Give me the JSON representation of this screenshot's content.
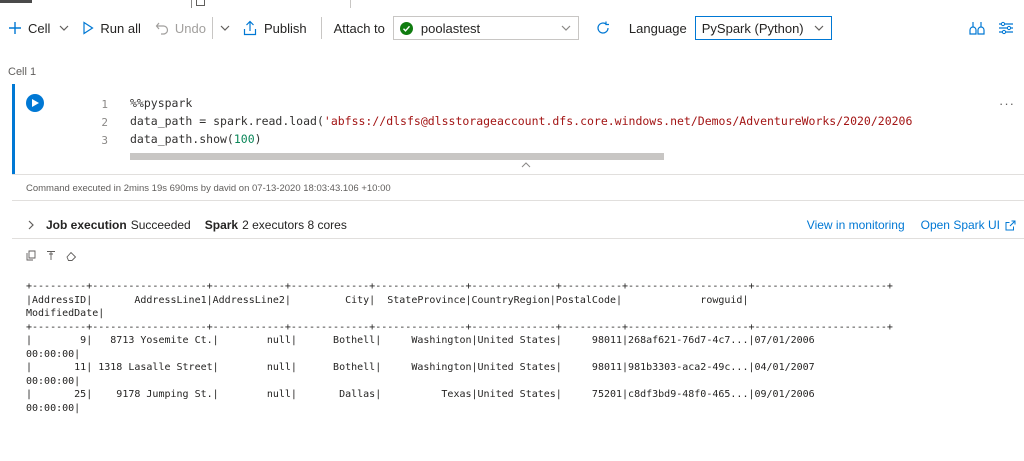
{
  "toolbar": {
    "cell_label": "Cell",
    "run_all_label": "Run all",
    "undo_label": "Undo",
    "publish_label": "Publish",
    "attach_label": "Attach to",
    "attach_value": "poolastest",
    "language_label": "Language",
    "language_value": "PySpark (Python)"
  },
  "cell": {
    "label": "Cell 1",
    "lines": [
      {
        "num": "1",
        "text": "%%pyspark"
      },
      {
        "num": "2",
        "prefix": "data_path = ",
        "spark": "spark",
        "mid": ".read.load(",
        "str": "'abfss://dlsfs@dlsstorageaccount.dfs.core.windows.net/Demos/AdventureWorks/2020/20206"
      },
      {
        "num": "3",
        "prefix": "data_path.show(",
        "numval": "100",
        "suffix": ")"
      }
    ]
  },
  "command_info": "Command executed in 2mins 19s 690ms by david on 07-13-2020 18:03:43.106 +10:00",
  "job": {
    "title": "Job execution",
    "status": "Succeeded",
    "spark_label": "Spark",
    "spark_detail": "2 executors 8 cores",
    "view_monitoring": "View in monitoring",
    "open_spark_ui": "Open Spark UI"
  },
  "output_text": "+---------+-------------------+------------+-------------+---------------+--------------+----------+--------------------+----------------------+\n|AddressID|       AddressLine1|AddressLine2|         City|  StateProvince|CountryRegion|PostalCode|             rowguid|\nModifiedDate|\n+---------+-------------------+------------+-------------+---------------+--------------+----------+--------------------+----------------------+\n|        9|   8713 Yosemite Ct.|        null|      Bothell|     Washington|United States|     98011|268af621-76d7-4c7...|07/01/2006\n00:00:00|\n|       11| 1318 Lasalle Street|        null|      Bothell|     Washington|United States|     98011|981b3303-aca2-49c...|04/01/2007\n00:00:00|\n|       25|    9178 Jumping St.|        null|       Dallas|          Texas|United States|     75201|c8df3bd9-48f0-465...|09/01/2006\n00:00:00|"
}
